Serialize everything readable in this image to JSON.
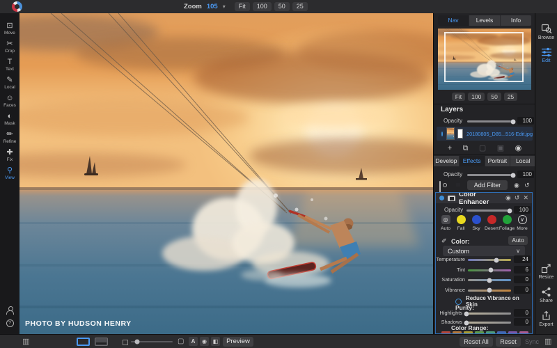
{
  "topbar": {
    "zoom_label": "Zoom",
    "zoom_value": "105",
    "zoom_presets": [
      "Fit",
      "100",
      "50",
      "25"
    ]
  },
  "toolbar": {
    "tools": [
      {
        "name": "tool-move",
        "icon": "move-icon",
        "glyph": "⊡",
        "label": "Move"
      },
      {
        "name": "tool-crop",
        "icon": "crop-icon",
        "glyph": "✂",
        "label": "Crop"
      },
      {
        "name": "tool-text",
        "icon": "text-icon",
        "glyph": "T",
        "label": "Text"
      },
      {
        "name": "tool-local",
        "icon": "local-icon",
        "glyph": "✎",
        "label": "Local"
      },
      {
        "name": "tool-faces",
        "icon": "faces-icon",
        "glyph": "☺",
        "label": "Faces"
      },
      {
        "name": "tool-mask",
        "icon": "mask-icon",
        "glyph": "◐",
        "label": "Mask"
      },
      {
        "name": "tool-refine",
        "icon": "refine-icon",
        "glyph": "✏",
        "label": "Refine"
      },
      {
        "name": "tool-fix",
        "icon": "fix-icon",
        "glyph": "✚",
        "label": "Fix"
      },
      {
        "name": "tool-view",
        "icon": "view-icon",
        "glyph": "⚲",
        "label": "View",
        "active": true
      }
    ]
  },
  "photo": {
    "watermark": "PHOTO BY HUDSON HENRY"
  },
  "panel": {
    "tabs": [
      {
        "label": "Nav",
        "active": true
      },
      {
        "label": "Levels"
      },
      {
        "label": "Info"
      }
    ],
    "nav_zoom": [
      "Fit",
      "100",
      "50",
      "25"
    ],
    "layers": {
      "title": "Layers",
      "opacity_label": "Opacity",
      "opacity_value": "100",
      "layer_name": "20180805_D85...516-Edit.jpg",
      "actions": [
        {
          "icon": "add-layer-icon",
          "glyph": "+"
        },
        {
          "icon": "duplicate-layer-icon",
          "glyph": "⧉"
        },
        {
          "icon": "delete-layer-icon",
          "glyph": "▢",
          "disabled": true
        },
        {
          "icon": "merge-layer-icon",
          "glyph": "▣",
          "disabled": true
        },
        {
          "icon": "layer-menu-icon",
          "glyph": "◉"
        }
      ]
    },
    "filter_tabs": [
      {
        "label": "Develop"
      },
      {
        "label": "Effects",
        "active": true
      },
      {
        "label": "Portrait"
      },
      {
        "label": "Local"
      }
    ],
    "effects": {
      "opacity_label": "Opacity",
      "opacity_value": "100",
      "add_filter_label": "Add Filter"
    }
  },
  "color_enhancer": {
    "title": "Color Enhancer",
    "opacity_label": "Opacity",
    "opacity_value": "100",
    "presets": [
      {
        "name": "preset-auto",
        "label": "Auto",
        "type": "camera",
        "color": "#4a4a4f",
        "glyph": "◎"
      },
      {
        "name": "preset-fall",
        "label": "Fall",
        "type": "color",
        "color": "#e8d81f",
        "glyph": ""
      },
      {
        "name": "preset-sky",
        "label": "Sky",
        "type": "color",
        "color": "#2b50cc",
        "glyph": ""
      },
      {
        "name": "preset-desert",
        "label": "Desert",
        "type": "color",
        "color": "#c62828",
        "glyph": ""
      },
      {
        "name": "preset-foliage",
        "label": "Foliage",
        "type": "color",
        "color": "#22a33a",
        "glyph": ""
      },
      {
        "name": "preset-more",
        "label": "More",
        "type": "chevron",
        "color": "transparent",
        "glyph": "∨"
      }
    ],
    "color_label": "Color:",
    "auto_button": "Auto",
    "color_mode": "Custom",
    "sliders": [
      {
        "label": "Temperature",
        "value": "24",
        "pct": "66%",
        "gradient": "linear-gradient(90deg,#6d77bd,#b9ab4d)"
      },
      {
        "label": "Tint",
        "value": "6",
        "pct": "54%",
        "gradient": "linear-gradient(90deg,#49973f,#a55fb2)"
      },
      {
        "label": "Saturation",
        "value": "0",
        "pct": "50%",
        "gradient": "linear-gradient(90deg,#97948e,#5f93c9)"
      },
      {
        "label": "Vibrance",
        "value": "0",
        "pct": "50%",
        "gradient": "linear-gradient(90deg,#97948e,#c4843c)"
      }
    ],
    "reduce_vibrance_label": "Reduce Vibrance on Skin",
    "purity_label": "Purity:",
    "purity_sliders": [
      {
        "label": "Highlights",
        "value": "0",
        "pct": "3%",
        "gradient": "linear-gradient(90deg,#b8b09a,#8f8f92)"
      },
      {
        "label": "Shadows",
        "value": "0",
        "pct": "3%",
        "gradient": "linear-gradient(90deg,#b8b09a,#8f8f92)"
      }
    ],
    "color_range_label": "Color Range:",
    "swatches": [
      "#b2463c",
      "#b2773c",
      "#a89b33",
      "#5d9a4c",
      "#4c9a7a",
      "#4465b2",
      "#7a55a8",
      "#aa5a90"
    ]
  },
  "module_strip": {
    "browse_label": "Browse",
    "edit_label": "Edit",
    "resize_label": "Resize",
    "share_label": "Share",
    "export_label": "Export"
  },
  "bottom_bar": {
    "preview_label": "Preview",
    "reset_all_label": "Reset All",
    "reset_label": "Reset",
    "sync_label": "Sync"
  }
}
